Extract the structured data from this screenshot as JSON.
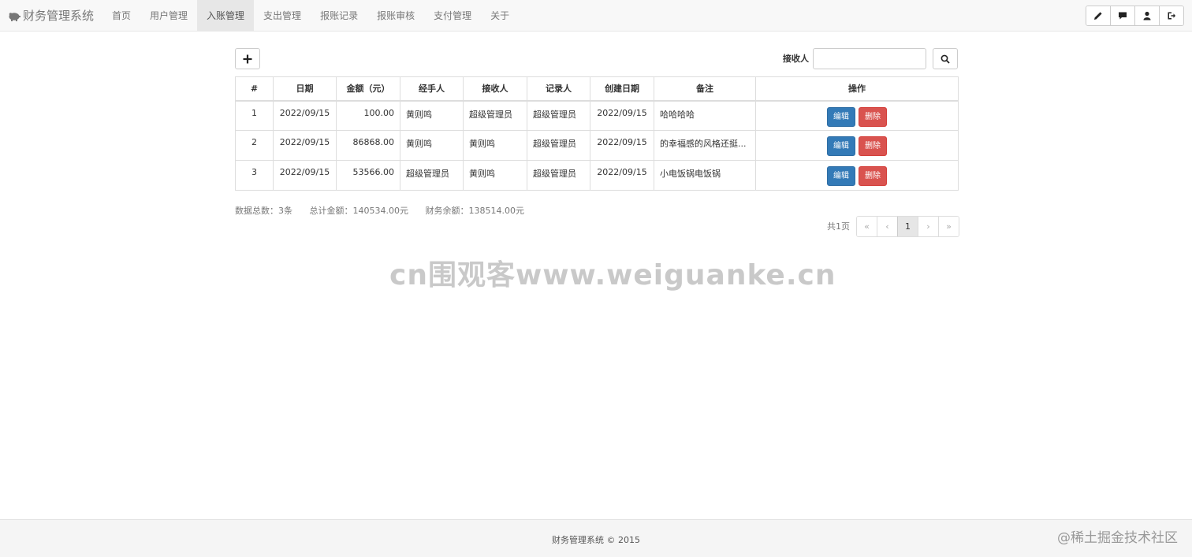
{
  "navbar": {
    "brand": "财务管理系统",
    "items": [
      {
        "label": "首页",
        "active": false
      },
      {
        "label": "用户管理",
        "active": false
      },
      {
        "label": "入账管理",
        "active": true
      },
      {
        "label": "支出管理",
        "active": false
      },
      {
        "label": "报账记录",
        "active": false
      },
      {
        "label": "报账审核",
        "active": false
      },
      {
        "label": "支付管理",
        "active": false
      },
      {
        "label": "关于",
        "active": false
      }
    ],
    "right_icons": [
      "pencil-icon",
      "comment-icon",
      "user-icon",
      "logout-icon"
    ]
  },
  "toolbar": {
    "add_icon": "plus-icon",
    "search_label": "接收人",
    "search_value": "",
    "search_icon": "search-icon"
  },
  "table": {
    "headers": [
      "#",
      "日期",
      "金额（元）",
      "经手人",
      "接收人",
      "记录人",
      "创建日期",
      "备注",
      "操作"
    ],
    "rows": [
      {
        "num": "1",
        "date": "2022/09/15",
        "amount": "100.00",
        "handler": "黄则鸣",
        "receiver": "超级管理员",
        "recorder": "超级管理员",
        "created": "2022/09/15",
        "note": "哈哈哈哈"
      },
      {
        "num": "2",
        "date": "2022/09/15",
        "amount": "86868.00",
        "handler": "黄则鸣",
        "receiver": "黄则鸣",
        "recorder": "超级管理员",
        "created": "2022/09/15",
        "note": "的幸福感的风格还挺..."
      },
      {
        "num": "3",
        "date": "2022/09/15",
        "amount": "53566.00",
        "handler": "超级管理员",
        "receiver": "黄则鸣",
        "recorder": "超级管理员",
        "created": "2022/09/15",
        "note": "小电饭锅电饭锅"
      }
    ],
    "edit_label": "编辑",
    "delete_label": "删除"
  },
  "summary": {
    "total_count": "数据总数：3条",
    "total_amount": "总计金额：140534.00元",
    "balance": "财务余额：138514.00元"
  },
  "pagination": {
    "label": "共1页",
    "first": "«",
    "prev": "‹",
    "current": "1",
    "next": "›",
    "last": "»"
  },
  "watermark": "cn围观客www.weiguanke.cn",
  "footer": {
    "text": "财务管理系统 © 2015",
    "mark": "@稀土掘金技术社区"
  },
  "colors": {
    "primary": "#337ab7",
    "danger": "#d9534f",
    "navbar_bg": "#f8f8f8"
  }
}
